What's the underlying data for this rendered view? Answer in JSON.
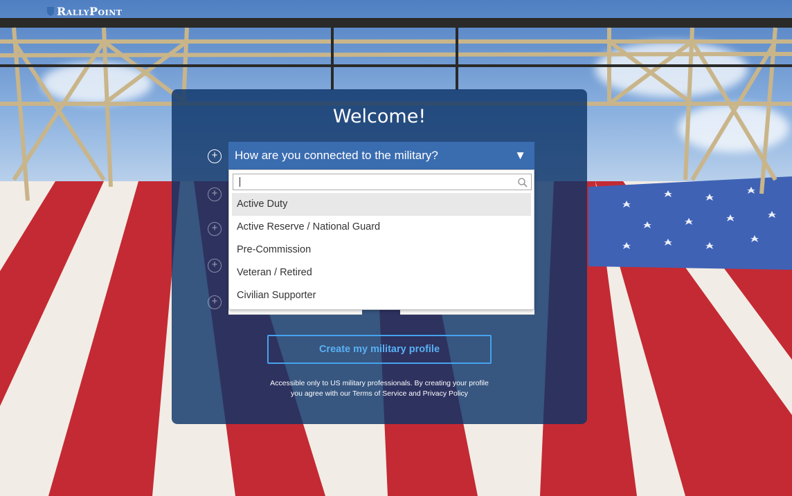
{
  "brand": {
    "logo_text": "RallyPoint"
  },
  "welcome": {
    "title": "Welcome!",
    "select_label": "How are you connected to the military?",
    "search_value": "",
    "options": [
      {
        "label": "Active Duty"
      },
      {
        "label": "Active Reserve / National Guard"
      },
      {
        "label": "Pre-Commission"
      },
      {
        "label": "Veteran / Retired"
      },
      {
        "label": "Civilian Supporter"
      }
    ],
    "cta_label": "Create my military profile",
    "legal_line1": "Accessible only to US military professionals. By creating your profile",
    "legal_line2_prefix": "you agree with our ",
    "terms_link": "Terms of Service",
    "and_text": " and ",
    "privacy_link": "Privacy Policy"
  },
  "colors": {
    "modal_bg": "#0e3469",
    "select_header": "#3a6cb0",
    "cta_border": "#46a3ee",
    "cta_text": "#58b1f5",
    "highlight": "#e8e8e8"
  },
  "icons": {
    "step": "plus-circle-icon",
    "caret": "caret-down-icon",
    "search": "search-icon",
    "logo": "shield-icon"
  }
}
